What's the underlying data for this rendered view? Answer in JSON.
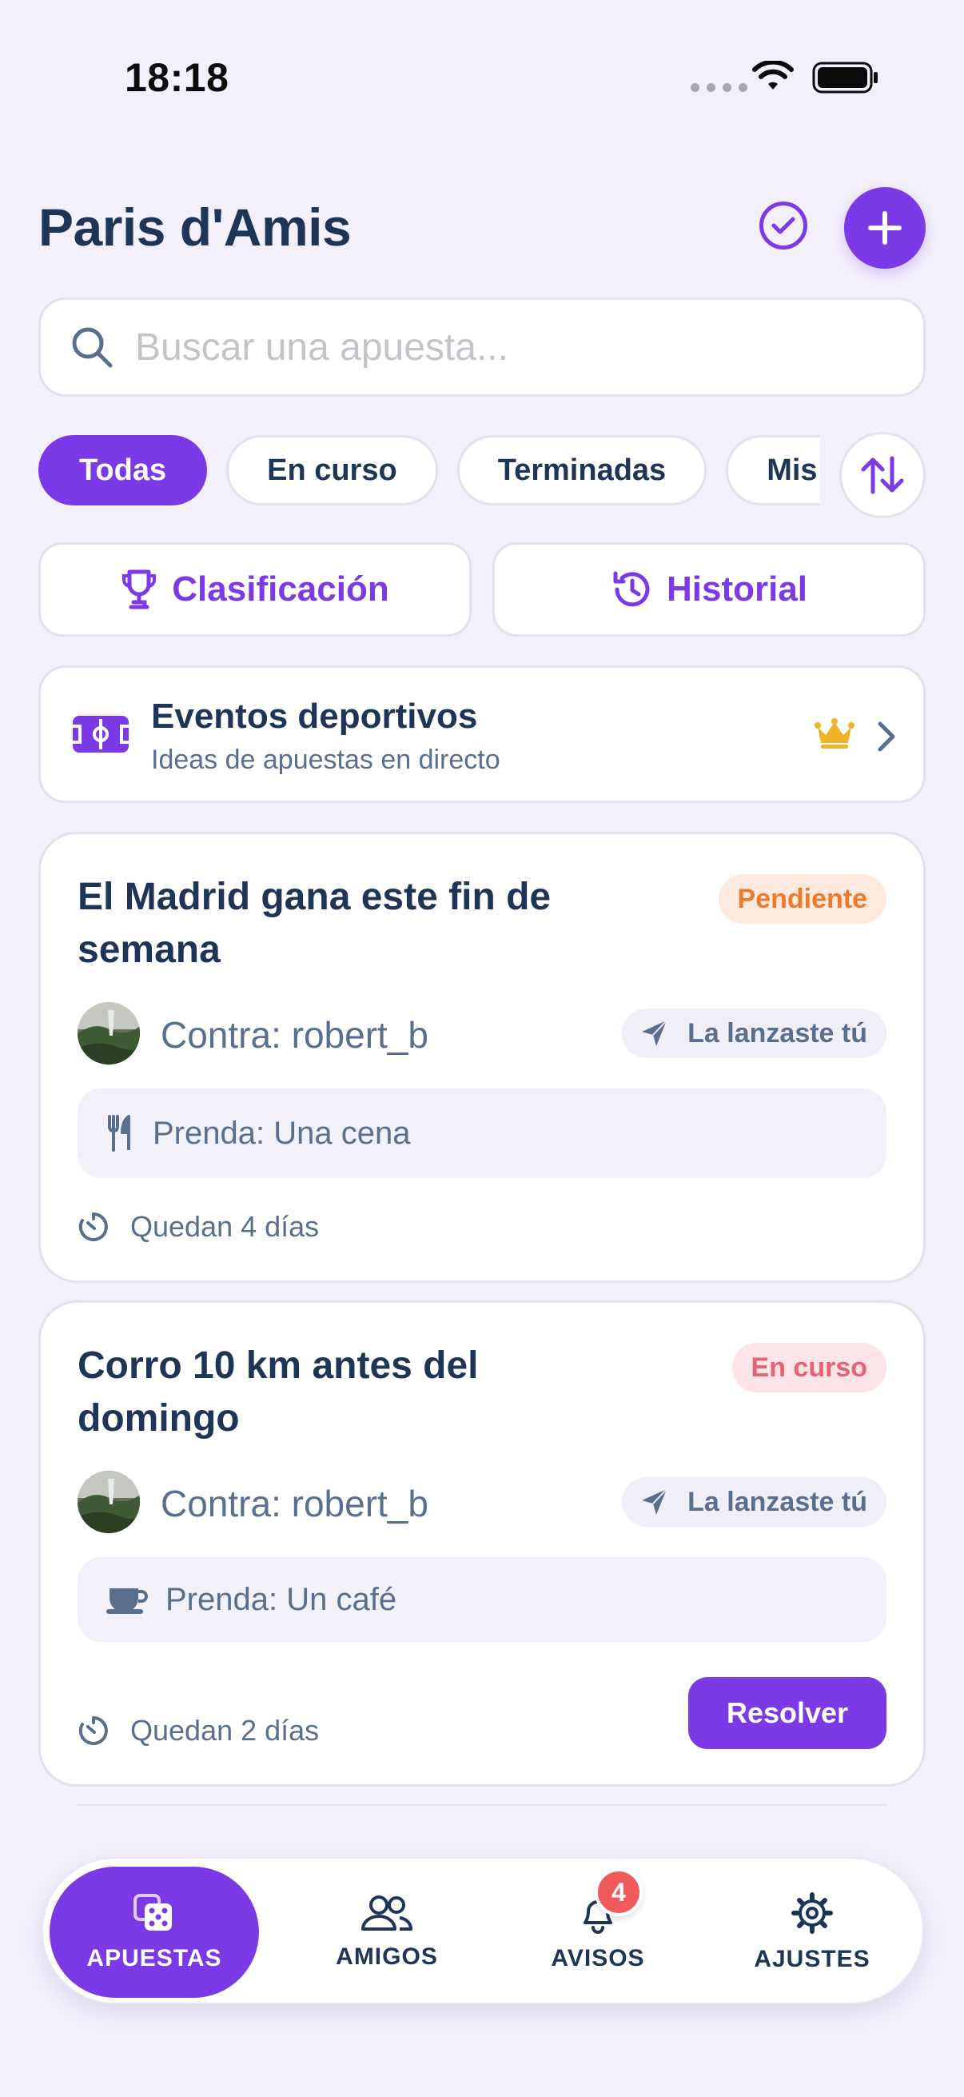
{
  "status_bar": {
    "time": "18:18"
  },
  "header": {
    "title": "Paris d'Amis"
  },
  "search": {
    "placeholder": "Buscar una apuesta..."
  },
  "filters": [
    "Todas",
    "En curso",
    "Terminadas",
    "Mis"
  ],
  "actions": {
    "ranking": "Clasificación",
    "history": "Historial"
  },
  "events": {
    "title": "Eventos deportivos",
    "subtitle": "Ideas de apuestas en directo"
  },
  "bets": [
    {
      "title": "El Madrid gana este fin de semana",
      "status": "Pendiente",
      "opponent": "Contra: robert_b",
      "origin": "La lanzaste tú",
      "stake": "Prenda: Una cena",
      "stake_icon": "fork-knife-icon",
      "deadline": "Quedan 4 días"
    },
    {
      "title": "Corro 10 km antes del domingo",
      "status": "En curso",
      "opponent": "Contra: robert_b",
      "origin": "La lanzaste tú",
      "stake": "Prenda: Un café",
      "stake_icon": "coffee-cup-icon",
      "deadline": "Quedan 2 días",
      "action": "Resolver"
    }
  ],
  "tabbar": {
    "items": [
      "APUESTAS",
      "AMIGOS",
      "AVISOS",
      "AJUSTES"
    ],
    "notifications_count": "4"
  },
  "colors": {
    "accent": "#7b3ae6",
    "background": "#f3f0fb",
    "text": "#1f3558",
    "pending": "#ee7b2b",
    "in_progress": "#e76275",
    "crown": "#f0b429",
    "badge": "#ef5a5a"
  }
}
